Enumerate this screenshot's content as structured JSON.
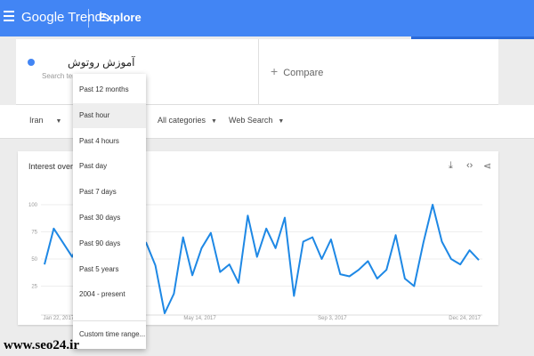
{
  "header": {
    "logo": "Google Trends",
    "section": "Explore",
    "colors": {
      "bar": "#4285f4"
    }
  },
  "search": {
    "term": "آموزش روتوش",
    "term_subtitle": "Search term",
    "compare_label": "Compare"
  },
  "filters": {
    "region": "Iran",
    "category": "All categories",
    "search_type": "Web Search"
  },
  "time_menu": {
    "items": [
      "Past 12 months",
      "Past hour",
      "Past 4 hours",
      "Past day",
      "Past 7 days",
      "Past 30 days",
      "Past 90 days",
      "Past 5 years",
      "2004 - present",
      "Custom time range..."
    ],
    "selected": "Past hour"
  },
  "chart": {
    "title": "Interest over time"
  },
  "chart_data": {
    "type": "line",
    "title": "Interest over time",
    "xlabel": "",
    "ylabel": "",
    "ylim": [
      0,
      100
    ],
    "y_ticks": [
      25,
      50,
      75,
      100
    ],
    "x_tick_labels": [
      "Jan 22, 2017",
      "May 14, 2017",
      "Sep 3, 2017",
      "Dec 24, 2017"
    ],
    "grid": true,
    "color": "#1e88e5",
    "values": [
      45,
      78,
      65,
      52,
      70,
      60,
      66,
      72,
      74,
      74,
      58,
      65,
      44,
      0,
      18,
      70,
      35,
      60,
      74,
      38,
      45,
      28,
      90,
      52,
      78,
      60,
      88,
      16,
      66,
      70,
      50,
      68,
      36,
      34,
      40,
      48,
      32,
      40,
      72,
      32,
      25,
      65,
      100,
      66,
      50,
      45,
      58,
      49
    ]
  },
  "watermark": "www.seo24.ir"
}
